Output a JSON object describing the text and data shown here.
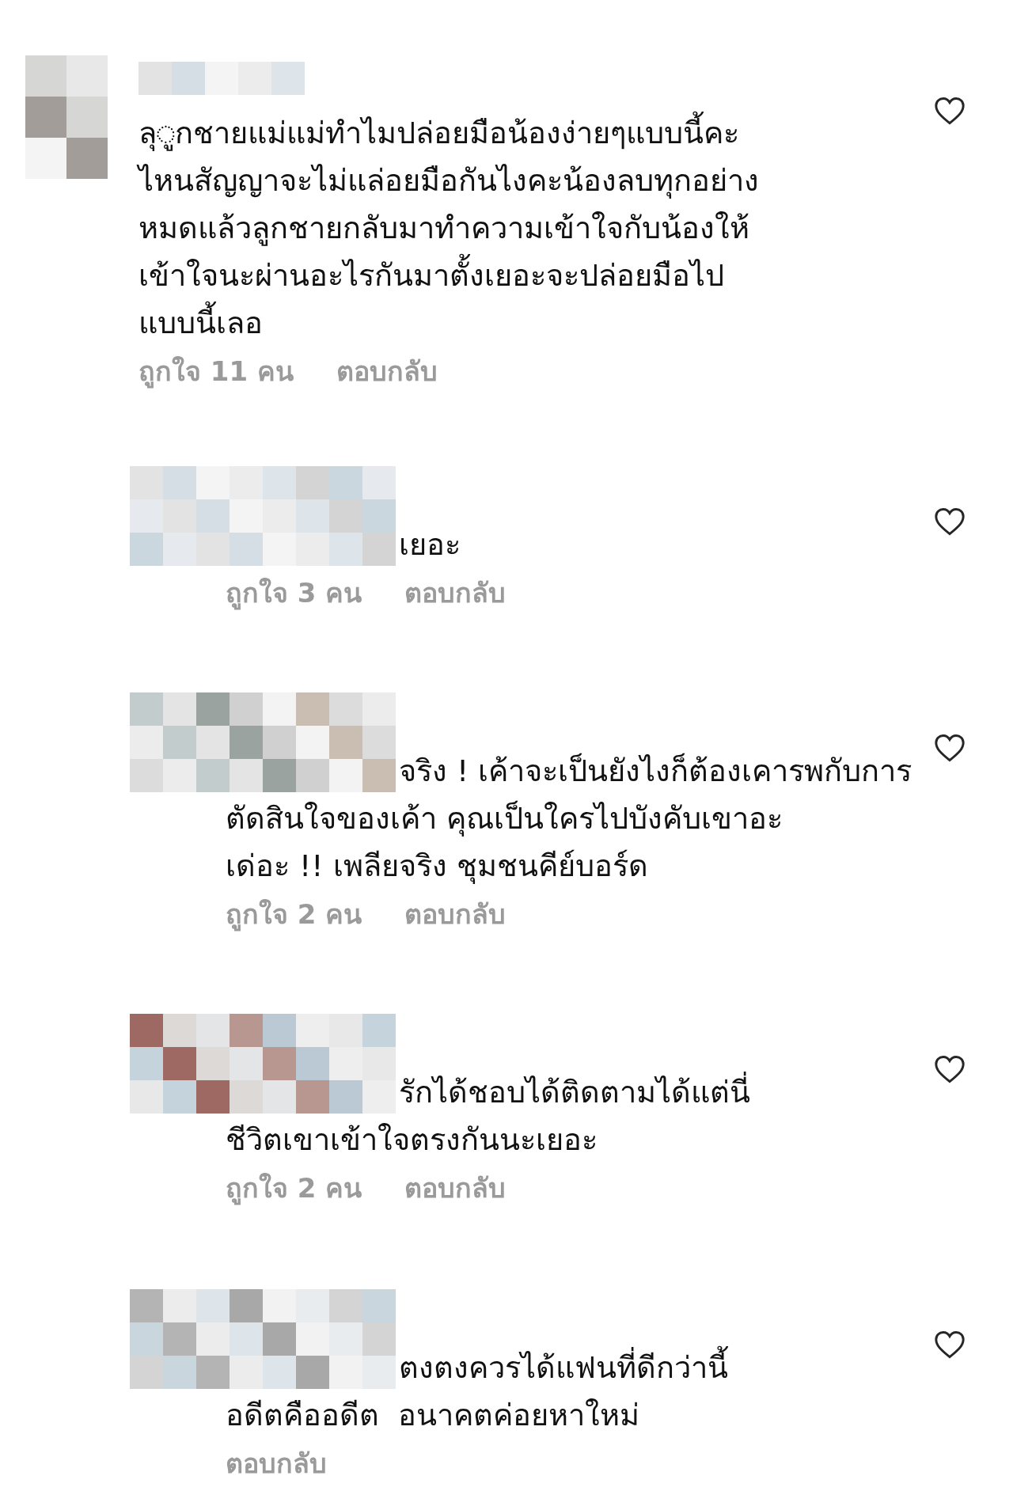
{
  "comments": [
    {
      "is_reply": false,
      "text": "ลุ◌ูกชายแม่แม่ทำไมปล่อยมือน้องง่ายๆแบบนี้คะ\nไหนสัญญาจะไม่แล่อยมือกันไงคะน้องลบทุกอย่าง\nหมดแล้วลูกชายกลับมาทำความเข้าใจกับน้องให้\nเข้าใจนะผ่านอะไรกันมาตั้งเยอะจะปล่อยมือไป\nแบบนี้เลอ",
      "likes": "ถูกใจ 11 คน",
      "reply": "ตอบกลับ",
      "liked": false
    },
    {
      "is_reply": true,
      "text": "เยอะ",
      "likes": "ถูกใจ 3 คน",
      "reply": "ตอบกลับ",
      "liked": false
    },
    {
      "is_reply": true,
      "text": "จริง ! เค้าจะเป็นยังไงก็ต้องเคารพกับการ\nตัดสินใจของเค้า คุณเป็นใครไปบังคับเขาอะ\nเด่อะ !! เพลียจริง ชุมชนคีย์บอร์ด",
      "likes": "ถูกใจ 2 คน",
      "reply": "ตอบกลับ",
      "liked": false
    },
    {
      "is_reply": true,
      "text": "รักได้ชอบได้ติดตามได้แต่นี่\nชีวิตเขาเข้าใจตรงกันนะเยอะ",
      "likes": "ถูกใจ 2 คน",
      "reply": "ตอบกลับ",
      "liked": false
    },
    {
      "is_reply": true,
      "text": "ตงตงควรได้แฟนที่ดีกว่านี้\nอดีตคืออดีต  อนาคตค่อยหาใหม่",
      "reply": "ตอบกลับ",
      "liked": false
    }
  ]
}
